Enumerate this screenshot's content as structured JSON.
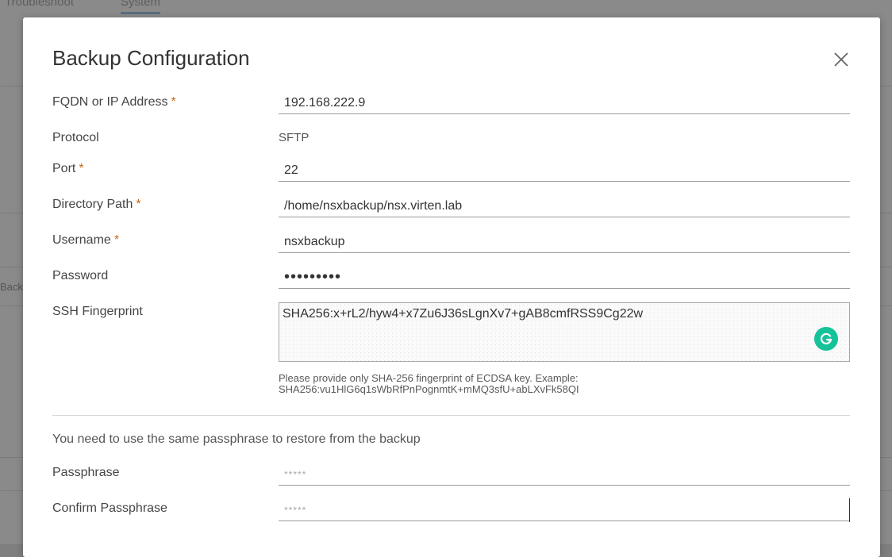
{
  "background": {
    "tabs": [
      "Troubleshoot",
      "System"
    ],
    "side_text": "Back"
  },
  "modal": {
    "title": "Backup Configuration",
    "close_icon": "close-icon"
  },
  "form": {
    "fqdn": {
      "label": "FQDN or IP Address",
      "required": "*",
      "value": "192.168.222.9"
    },
    "protocol": {
      "label": "Protocol",
      "value": "SFTP"
    },
    "port": {
      "label": "Port",
      "required": "*",
      "value": "22"
    },
    "directory": {
      "label": "Directory Path",
      "required": "*",
      "value": "/home/nsxbackup/nsx.virten.lab"
    },
    "username": {
      "label": "Username",
      "required": "*",
      "value": "nsxbackup"
    },
    "password": {
      "label": "Password",
      "value": "•••••••••"
    },
    "ssh": {
      "label": "SSH Fingerprint",
      "value": "SHA256:x+rL2/hyw4+x7Zu6J36sLgnXv7+gAB8cmfRSS9Cg22w",
      "hint_line1": "Please provide only SHA-256 fingerprint of ECDSA key. Example:",
      "hint_line2": "SHA256:vu1HlG6q1sWbRfPnPognmtK+mMQ3sfU+abLXvFk58QI"
    },
    "notice": "You need to use the same passphrase to restore from the backup",
    "passphrase": {
      "label": "Passphrase",
      "placeholder": "*****"
    },
    "confirm_passphrase": {
      "label": "Confirm Passphrase",
      "placeholder": "*****"
    }
  },
  "colors": {
    "required": "#c46a1c",
    "grammarly": "#15c39a"
  }
}
